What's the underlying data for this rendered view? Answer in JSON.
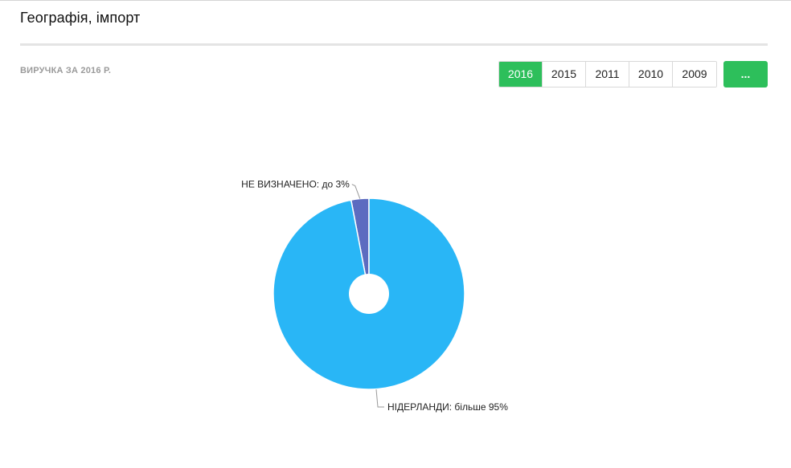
{
  "header": {
    "title": "Географія, імпорт"
  },
  "revenue_label": "ВИРУЧКА ЗА 2016 Р.",
  "year_tabs": [
    {
      "label": "2016",
      "active": true
    },
    {
      "label": "2015",
      "active": false
    },
    {
      "label": "2011",
      "active": false
    },
    {
      "label": "2010",
      "active": false
    },
    {
      "label": "2009",
      "active": false
    }
  ],
  "more_button": {
    "label": "..."
  },
  "colors": {
    "accent": "#2dbf5b",
    "slice_main": "#29b6f6",
    "slice_minor": "#5c6bc0"
  },
  "chart_data": {
    "type": "pie",
    "slices": [
      {
        "name": "НЕ ВИЗНАЧЕНО",
        "value": 3,
        "label": "НЕ ВИЗНАЧЕНО: до 3%",
        "color": "#5c6bc0"
      },
      {
        "name": "НІДЕРЛАНДИ",
        "value": 97,
        "label": "НІДЕРЛАНДИ: більше 95%",
        "color": "#29b6f6"
      }
    ],
    "legend": "none"
  }
}
